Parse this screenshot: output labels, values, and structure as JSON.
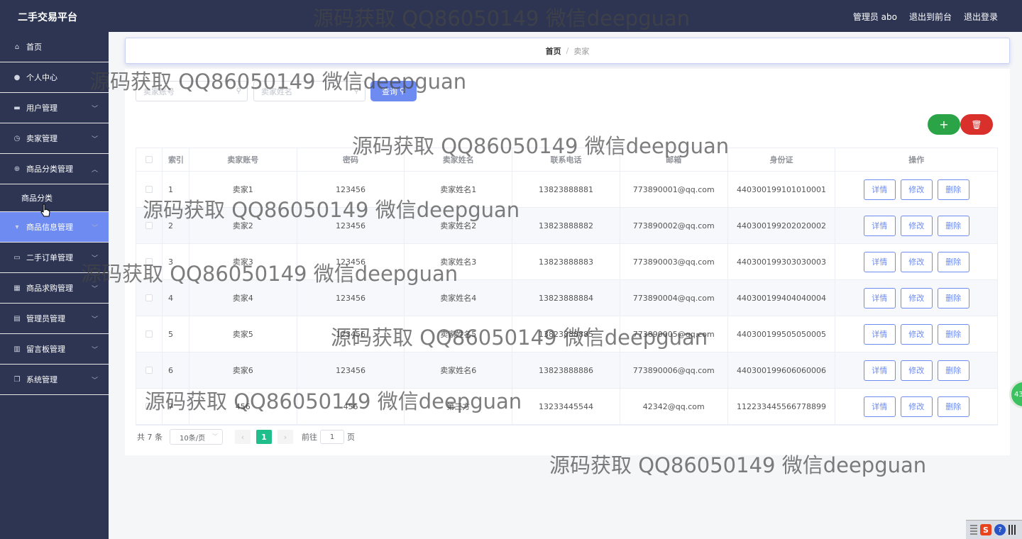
{
  "header": {
    "brand": "二手交易平台",
    "links": [
      "管理员 abo",
      "退出到前台",
      "退出登录"
    ]
  },
  "sidebar": {
    "items": [
      {
        "label": "首页",
        "icon": "home-icon",
        "glyph": "⌂",
        "chevron": ""
      },
      {
        "label": "个人中心",
        "icon": "user-icon",
        "glyph": "●",
        "chevron": ""
      },
      {
        "label": "用户管理",
        "icon": "monitor-icon",
        "glyph": "▬",
        "chevron": "﹀"
      },
      {
        "label": "卖家管理",
        "icon": "clock-icon",
        "glyph": "◷",
        "chevron": "﹀"
      },
      {
        "label": "商品分类管理",
        "icon": "compass-icon",
        "glyph": "⊕",
        "chevron": "︿"
      },
      {
        "label": "商品分类",
        "icon": "",
        "glyph": "",
        "chevron": ""
      },
      {
        "label": "商品信息管理",
        "icon": "tag-icon",
        "glyph": "▾",
        "chevron": "﹀"
      },
      {
        "label": "二手订单管理",
        "icon": "ticket-icon",
        "glyph": "▭",
        "chevron": "﹀"
      },
      {
        "label": "商品求购管理",
        "icon": "grid-icon",
        "glyph": "▦",
        "chevron": "﹀"
      },
      {
        "label": "管理员管理",
        "icon": "table-icon",
        "glyph": "▤",
        "chevron": "﹀"
      },
      {
        "label": "留言板管理",
        "icon": "chart-icon",
        "glyph": "▥",
        "chevron": "﹀"
      },
      {
        "label": "系统管理",
        "icon": "copy-icon",
        "glyph": "❐",
        "chevron": "﹀"
      }
    ]
  },
  "breadcrumb": {
    "home": "首页",
    "separator": "/",
    "current": "卖家"
  },
  "search": {
    "account_placeholder": "卖家账号",
    "name_placeholder": "卖家姓名",
    "query_label": "查询",
    "search_glyph": "⚲"
  },
  "actions": {
    "add_glyph": "+",
    "delete_glyph": "🗑"
  },
  "table": {
    "headers": [
      "索引",
      "卖家账号",
      "密码",
      "卖家姓名",
      "联系电话",
      "邮箱",
      "身份证",
      "操作"
    ],
    "op_labels": [
      "详情",
      "修改",
      "删除"
    ],
    "rows": [
      [
        "1",
        "卖家1",
        "123456",
        "卖家姓名1",
        "13823888881",
        "773890001@qq.com",
        "440300199101010001"
      ],
      [
        "2",
        "卖家2",
        "123456",
        "卖家姓名2",
        "13823888882",
        "773890002@qq.com",
        "440300199202020002"
      ],
      [
        "3",
        "卖家3",
        "123456",
        "卖家姓名3",
        "13823888883",
        "773890003@qq.com",
        "440300199303030003"
      ],
      [
        "4",
        "卖家4",
        "123456",
        "卖家姓名4",
        "13823888884",
        "773890004@qq.com",
        "440300199404040004"
      ],
      [
        "5",
        "卖家5",
        "123456",
        "卖家姓名5",
        "13823888885",
        "773890005@qq.com",
        "440300199505050005"
      ],
      [
        "6",
        "卖家6",
        "123456",
        "卖家姓名6",
        "13823888886",
        "773890006@qq.com",
        "440300199606060006"
      ],
      [
        "7",
        "456",
        "456",
        "第三方",
        "13233445544",
        "42342@qq.com",
        "112233445566778899"
      ]
    ]
  },
  "pagination": {
    "total": "共 7 条",
    "page_size": "10条/页",
    "size_arrow": "﹀",
    "prev": "‹",
    "current": "1",
    "next": "›",
    "goto_prefix": "前往",
    "goto_value": "1",
    "goto_suffix": "页"
  },
  "watermark": "源码获取 QQ86050149 微信deepguan",
  "tray": {
    "s_label": "S",
    "q_label": "?",
    "float_label": "43"
  }
}
